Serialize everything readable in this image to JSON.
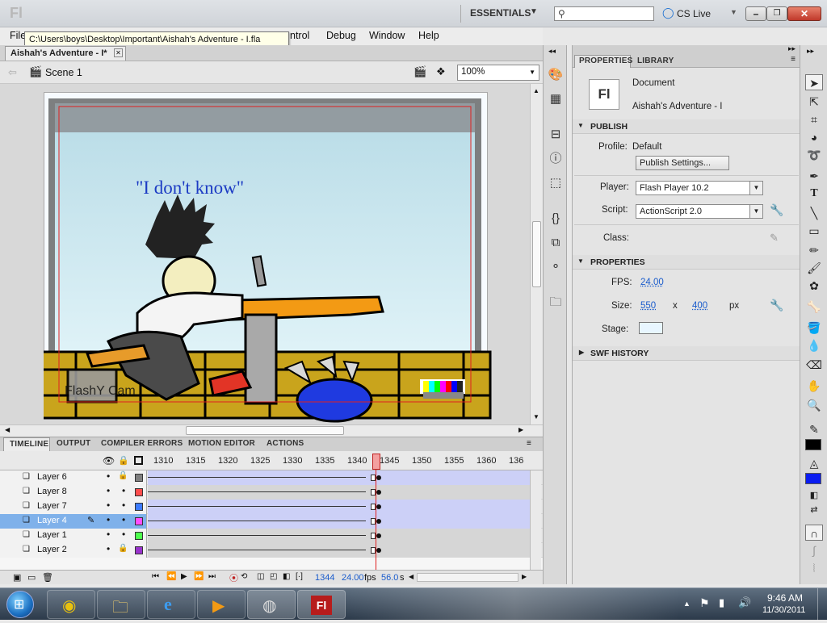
{
  "app": {
    "logo": "Fl",
    "workspace": "ESSENTIALS",
    "search_placeholder": "",
    "cs_live": "CS Live",
    "tooltip_path": "C:\\Users\\boys\\Desktop\\Important\\Aishah's Adventure - I.fla"
  },
  "menu": {
    "file": "File",
    "control": "ntrol",
    "debug": "Debug",
    "window": "Window",
    "help": "Help"
  },
  "document_tab": {
    "label": "Aishah's Adventure - I*"
  },
  "scene": {
    "label": "Scene 1",
    "zoom": "100%"
  },
  "stage": {
    "speech_text": "\"I don't know\"",
    "watermark": "FlashY Cam"
  },
  "timeline_tabs": [
    "TIMELINE",
    "OUTPUT",
    "COMPILER ERRORS",
    "MOTION EDITOR",
    "ACTIONS"
  ],
  "timeline": {
    "frame_ticks": [
      "1310",
      "1315",
      "1320",
      "1325",
      "1330",
      "1335",
      "1340",
      "1345",
      "1350",
      "1355",
      "1360",
      "136"
    ],
    "layers": [
      {
        "name": "Layer 6",
        "locked": true,
        "color": "#7f7f7f"
      },
      {
        "name": "Layer 8",
        "locked": false,
        "color": "#ff4d4d"
      },
      {
        "name": "Layer 7",
        "locked": false,
        "color": "#3d7bff"
      },
      {
        "name": "Layer 4",
        "locked": false,
        "color": "#ff4dff",
        "selected": true
      },
      {
        "name": "Layer 1",
        "locked": false,
        "color": "#4dff4d"
      },
      {
        "name": "Layer 2",
        "locked": true,
        "color": "#9933cc"
      }
    ],
    "current_frame": "1344",
    "fps": "24.00",
    "fps_unit": "fps",
    "time": "56.0",
    "time_unit": "s"
  },
  "properties": {
    "tabs": [
      "PROPERTIES",
      "LIBRARY"
    ],
    "doc_type": "Document",
    "doc_name": "Aishah's Adventure - I",
    "publish_header": "PUBLISH",
    "profile_label": "Profile:",
    "profile_value": "Default",
    "publish_settings": "Publish Settings...",
    "player_label": "Player:",
    "player_value": "Flash Player 10.2",
    "script_label": "Script:",
    "script_value": "ActionScript 2.0",
    "class_label": "Class:",
    "properties_header": "PROPERTIES",
    "fps_label": "FPS:",
    "fps_value": "24.00",
    "size_label": "Size:",
    "width": "550",
    "x": "x",
    "height": "400",
    "px": "px",
    "stage_label": "Stage:",
    "stage_color": "#e8f6ff",
    "swf_history": "SWF HISTORY"
  },
  "taskbar": {
    "time": "9:46 AM",
    "date": "11/30/2011"
  }
}
